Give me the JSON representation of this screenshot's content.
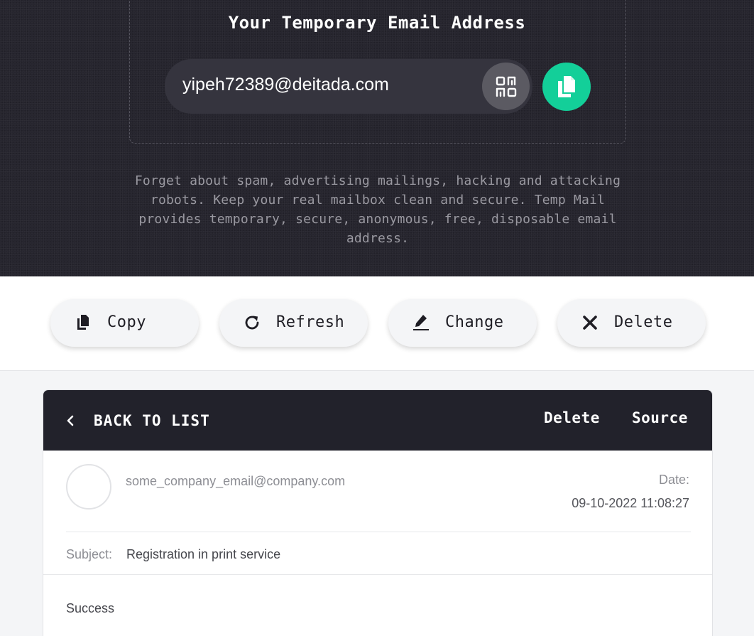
{
  "hero": {
    "title": "Your Temporary Email Address",
    "email": "yipeh72389@deitada.com",
    "description": "Forget about spam, advertising mailings, hacking and attacking robots. Keep your real mailbox clean and secure. Temp Mail provides temporary, secure, anonymous, free, disposable email address.",
    "qr_icon": "qr-code-icon",
    "copy_icon": "copy-icon"
  },
  "actions": [
    {
      "label": "Copy",
      "icon": "copy-icon"
    },
    {
      "label": "Refresh",
      "icon": "refresh-icon"
    },
    {
      "label": "Change",
      "icon": "edit-icon"
    },
    {
      "label": "Delete",
      "icon": "close-icon"
    }
  ],
  "message": {
    "back_label": "BACK TO LIST",
    "delete_label": "Delete",
    "source_label": "Source",
    "sender": "some_company_email@company.com",
    "date_label": "Date:",
    "date_value": "09-10-2022 11:08:27",
    "subject_label": "Subject:",
    "subject_value": "Registration in print service",
    "body": "Success"
  },
  "colors": {
    "hero_bg": "#26252e",
    "accent_green": "#13cf99",
    "card_header_bg": "#22222b"
  }
}
